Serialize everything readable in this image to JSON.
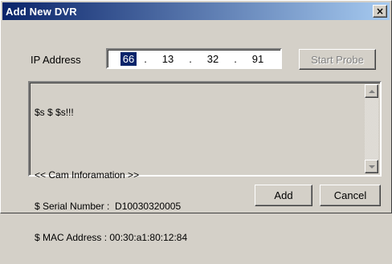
{
  "window": {
    "title": "Add New DVR",
    "close_glyph": "×",
    "titlebar_gradient": [
      "#0a246a",
      "#a6caf0"
    ]
  },
  "ip": {
    "label": "IP Address",
    "octets": [
      "66",
      "13",
      "32",
      "91"
    ],
    "separator": "."
  },
  "buttons": {
    "start_probe": "Start Probe",
    "add": "Add",
    "cancel": "Cancel"
  },
  "log": {
    "lines": [
      "$s $ $s!!!",
      "",
      "<< Cam Inforamation >>",
      "$ Serial Number :  D10030320005",
      "$ MAC Address : 00:30:a1:80:12:84"
    ]
  }
}
